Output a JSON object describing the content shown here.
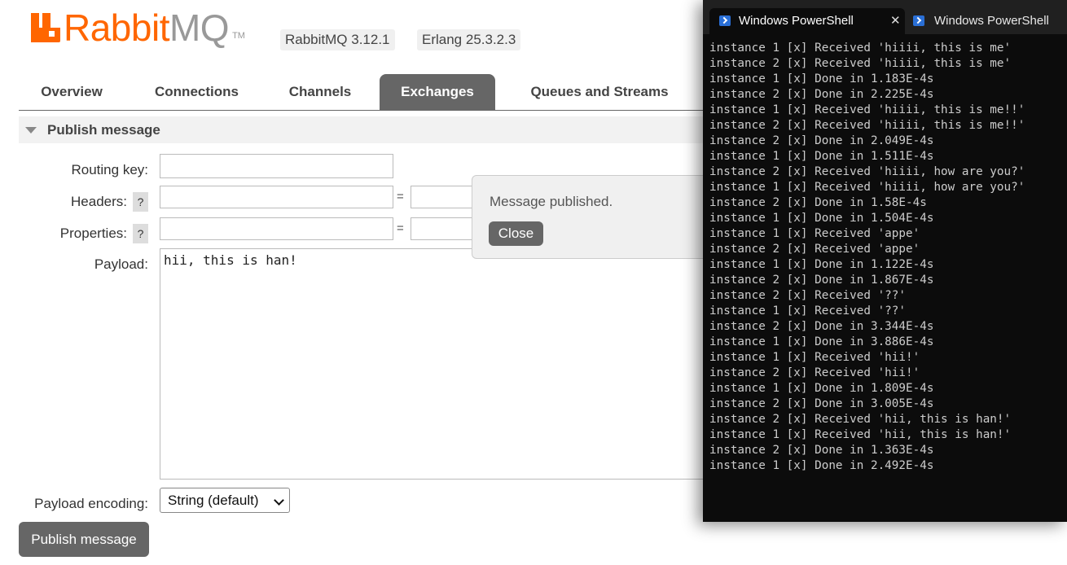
{
  "header": {
    "logo_text": "RabbitMQ",
    "logo_tm": "TM",
    "versions": [
      "RabbitMQ 3.12.1",
      "Erlang 25.3.2.3"
    ]
  },
  "tabs": [
    {
      "label": "Overview",
      "active": false
    },
    {
      "label": "Connections",
      "active": false
    },
    {
      "label": "Channels",
      "active": false
    },
    {
      "label": "Exchanges",
      "active": true
    },
    {
      "label": "Queues and Streams",
      "active": false
    }
  ],
  "publish": {
    "section_title": "Publish message",
    "routing_key_label": "Routing key:",
    "routing_key_value": "",
    "headers_label": "Headers:",
    "properties_label": "Properties:",
    "help": "?",
    "eq": "=",
    "payload_label": "Payload:",
    "payload_value": "hii, this is han!",
    "encoding_label": "Payload encoding:",
    "encoding_value": "String (default)",
    "button_label": "Publish message"
  },
  "popup": {
    "message": "Message published.",
    "close_label": "Close"
  },
  "powershell": {
    "tabs": [
      {
        "label": "Windows PowerShell",
        "active": true
      },
      {
        "label": "Windows PowerShell",
        "active": false
      }
    ],
    "close_glyph": "✕",
    "lines": [
      "instance 1 [x] Received 'hiiii, this is me'",
      "instance 2 [x] Received 'hiiii, this is me'",
      "instance 1 [x] Done in 1.183E-4s",
      "instance 2 [x] Done in 2.225E-4s",
      "instance 1 [x] Received 'hiiii, this is me!!'",
      "instance 2 [x] Received 'hiiii, this is me!!'",
      "instance 2 [x] Done in 2.049E-4s",
      "instance 1 [x] Done in 1.511E-4s",
      "instance 2 [x] Received 'hiiii, how are you?'",
      "instance 1 [x] Received 'hiiii, how are you?'",
      "instance 2 [x] Done in 1.58E-4s",
      "instance 1 [x] Done in 1.504E-4s",
      "instance 1 [x] Received 'appe'",
      "instance 2 [x] Received 'appe'",
      "instance 1 [x] Done in 1.122E-4s",
      "instance 2 [x] Done in 1.867E-4s",
      "instance 2 [x] Received '??'",
      "instance 1 [x] Received '??'",
      "instance 2 [x] Done in 3.344E-4s",
      "instance 1 [x] Done in 3.886E-4s",
      "instance 1 [x] Received 'hii!'",
      "instance 2 [x] Received 'hii!'",
      "instance 1 [x] Done in 1.809E-4s",
      "instance 2 [x] Done in 3.005E-4s",
      "instance 2 [x] Received 'hii, this is han!'",
      "instance 1 [x] Received 'hii, this is han!'",
      "instance 2 [x] Done in 1.363E-4s",
      "instance 1 [x] Done in 2.492E-4s"
    ]
  },
  "colors": {
    "brand_orange": "#ff6600",
    "tab_active_bg": "#666666",
    "terminal_bg": "#0c0c0c",
    "terminal_text": "#cccccc"
  }
}
